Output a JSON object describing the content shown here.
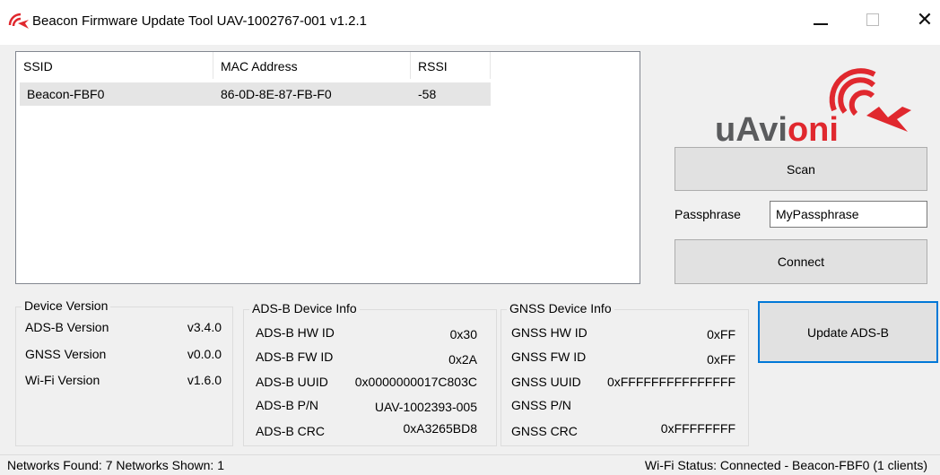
{
  "window": {
    "title": "Beacon Firmware Update Tool UAV-1002767-001 v1.2.1",
    "controls": {
      "minimize": "minimize",
      "maximize": "maximize",
      "close": "✕"
    }
  },
  "networks": {
    "columns": [
      "SSID",
      "MAC Address",
      "RSSI"
    ],
    "rows": [
      {
        "ssid": "Beacon-FBF0",
        "mac": "86-0D-8E-87-FB-F0",
        "rssi": "-58"
      }
    ]
  },
  "logo": {
    "text_dark": "uAvi",
    "text_red": "oni",
    "brand_dark": "#5a5b5d",
    "brand_red": "#e0282e"
  },
  "actions": {
    "scan_label": "Scan",
    "passphrase_label": "Passphrase",
    "passphrase_value": "MyPassphrase",
    "connect_label": "Connect",
    "update_label": "Update ADS-B",
    "update_border": "#0078d7"
  },
  "device_version": {
    "title": "Device Version",
    "rows": [
      {
        "label": "ADS-B Version",
        "value": "v3.4.0"
      },
      {
        "label": "GNSS Version",
        "value": "v0.0.0"
      },
      {
        "label": "Wi-Fi Version",
        "value": "v1.6.0"
      }
    ]
  },
  "adsb_info": {
    "title": "ADS-B Device Info",
    "rows": [
      {
        "label": "ADS-B HW ID",
        "value": "0x30"
      },
      {
        "label": "ADS-B FW ID",
        "value": "0x2A"
      },
      {
        "label": "ADS-B UUID",
        "value": "0x0000000017C803C"
      },
      {
        "label": "ADS-B P/N",
        "value": "UAV-1002393-005"
      },
      {
        "label": "ADS-B CRC",
        "value": "0xA3265BD8"
      }
    ]
  },
  "gnss_info": {
    "title": "GNSS Device Info",
    "rows": [
      {
        "label": "GNSS HW ID",
        "value": "0xFF"
      },
      {
        "label": "GNSS FW ID",
        "value": "0xFF"
      },
      {
        "label": "GNSS UUID",
        "value": "0xFFFFFFFFFFFFFFF"
      },
      {
        "label": "GNSS P/N",
        "value": ""
      },
      {
        "label": "GNSS CRC",
        "value": "0xFFFFFFFF"
      }
    ]
  },
  "status": {
    "left": "Networks Found:  7  Networks Shown:  1",
    "right": "Wi-Fi Status:  Connected - Beacon-FBF0 (1 clients)"
  }
}
